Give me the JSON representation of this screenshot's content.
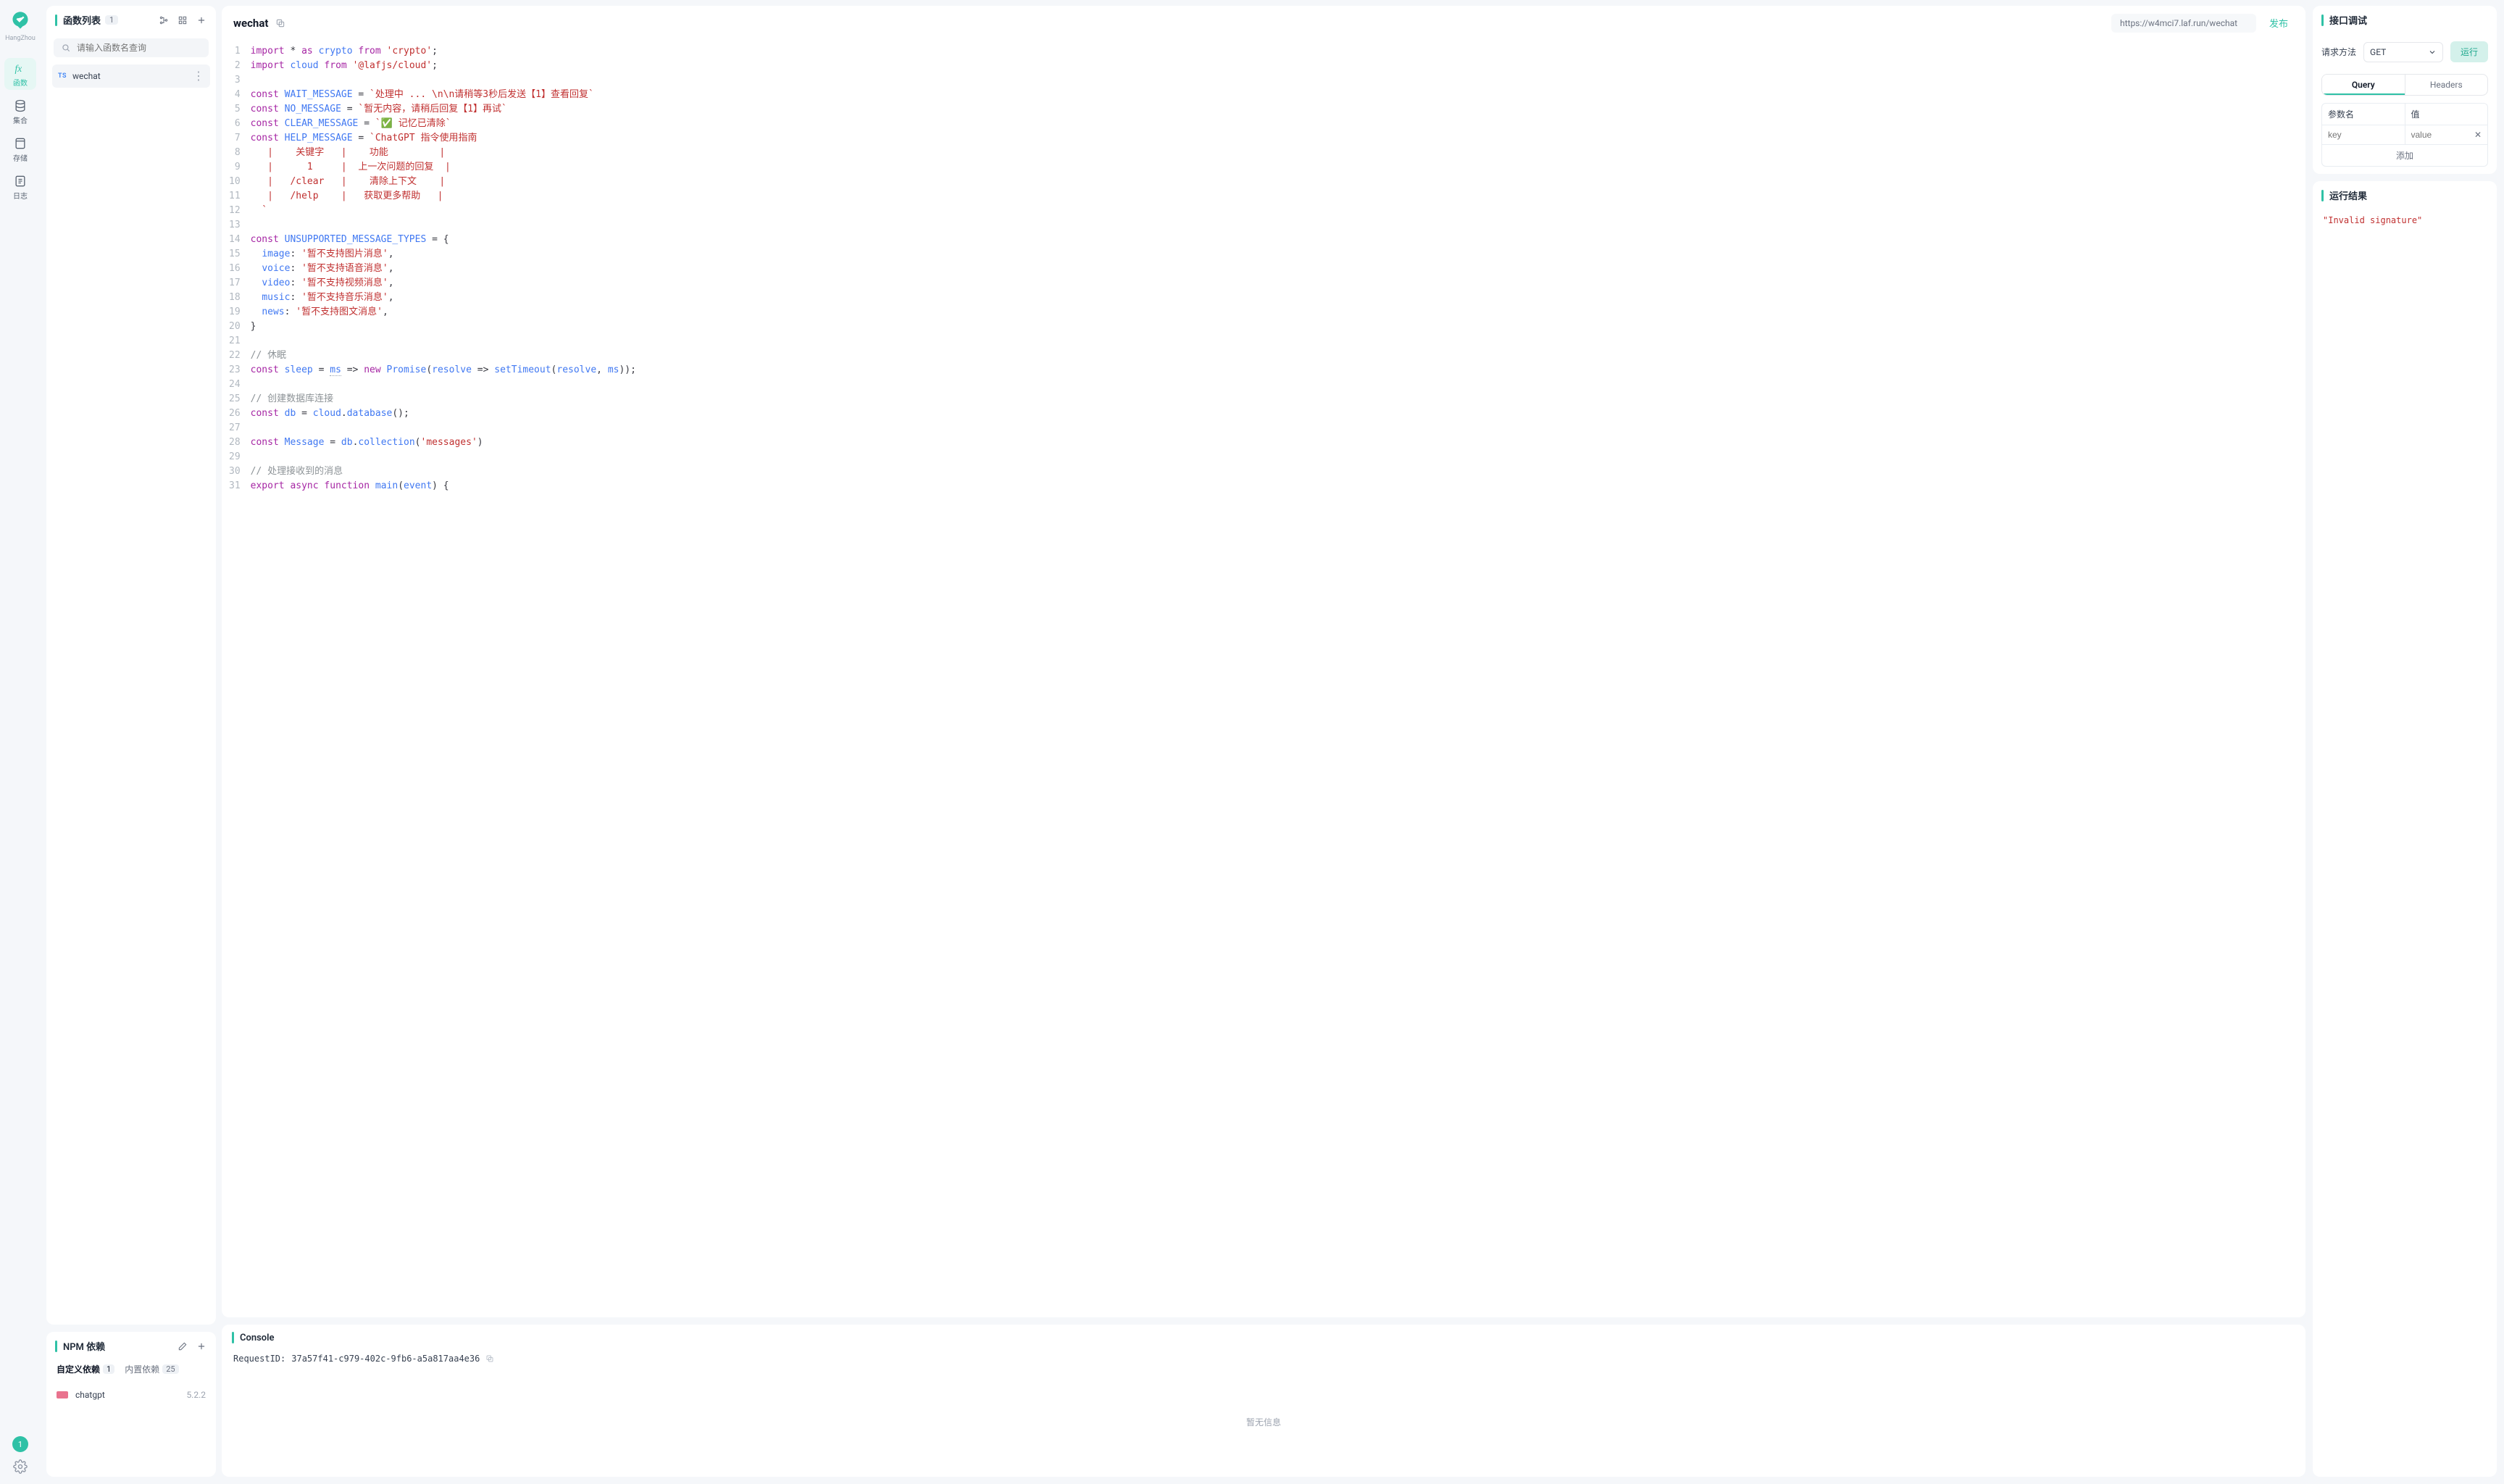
{
  "brand": "HangZhou",
  "rail": {
    "items": [
      {
        "label": "函数"
      },
      {
        "label": "集合"
      },
      {
        "label": "存储"
      },
      {
        "label": "日志"
      }
    ],
    "badge": "1"
  },
  "func_panel": {
    "title": "函数列表",
    "count": "1",
    "search_placeholder": "请输入函数名查询",
    "items": [
      {
        "badge": "TS",
        "name": "wechat"
      }
    ]
  },
  "npm_panel": {
    "title": "NPM 依赖",
    "tabs": [
      {
        "label": "自定义依赖",
        "count": "1"
      },
      {
        "label": "内置依赖",
        "count": "25"
      }
    ],
    "deps": [
      {
        "name": "chatgpt",
        "version": "5.2.2"
      }
    ]
  },
  "editor": {
    "title": "wechat",
    "url": "https://w4mci7.laf.run/wechat",
    "publish": "发布",
    "code_lines": [
      [
        [
          "kw",
          "import"
        ],
        [
          "op",
          " * "
        ],
        [
          "kw",
          "as"
        ],
        [
          "op",
          " "
        ],
        [
          "id",
          "crypto"
        ],
        [
          "op",
          " "
        ],
        [
          "kw",
          "from"
        ],
        [
          "op",
          " "
        ],
        [
          "str",
          "'crypto'"
        ],
        [
          "op",
          ";"
        ]
      ],
      [
        [
          "kw",
          "import"
        ],
        [
          "op",
          " "
        ],
        [
          "id",
          "cloud"
        ],
        [
          "op",
          " "
        ],
        [
          "kw",
          "from"
        ],
        [
          "op",
          " "
        ],
        [
          "str",
          "'@lafjs/cloud'"
        ],
        [
          "op",
          ";"
        ]
      ],
      [],
      [
        [
          "kw",
          "const"
        ],
        [
          "op",
          " "
        ],
        [
          "id",
          "WAIT_MESSAGE"
        ],
        [
          "op",
          " = "
        ],
        [
          "str",
          "`处理中 ... \\n\\n请稍等3秒后发送【1】查看回复`"
        ]
      ],
      [
        [
          "kw",
          "const"
        ],
        [
          "op",
          " "
        ],
        [
          "id",
          "NO_MESSAGE"
        ],
        [
          "op",
          " = "
        ],
        [
          "str",
          "`暂无内容，请稍后回复【1】再试`"
        ]
      ],
      [
        [
          "kw",
          "const"
        ],
        [
          "op",
          " "
        ],
        [
          "id",
          "CLEAR_MESSAGE"
        ],
        [
          "op",
          " = "
        ],
        [
          "str",
          "`✅ 记忆已清除`"
        ]
      ],
      [
        [
          "kw",
          "const"
        ],
        [
          "op",
          " "
        ],
        [
          "id",
          "HELP_MESSAGE"
        ],
        [
          "op",
          " = "
        ],
        [
          "str",
          "`ChatGPT 指令使用指南"
        ]
      ],
      [
        [
          "str",
          "   |    关键字   |    功能         |"
        ]
      ],
      [
        [
          "str",
          "   |      1     |  上一次问题的回复  |"
        ]
      ],
      [
        [
          "str",
          "   |   /clear   |    清除上下文    |"
        ]
      ],
      [
        [
          "str",
          "   |   /help    |   获取更多帮助   |"
        ]
      ],
      [
        [
          "str",
          "  `"
        ]
      ],
      [],
      [
        [
          "kw",
          "const"
        ],
        [
          "op",
          " "
        ],
        [
          "id",
          "UNSUPPORTED_MESSAGE_TYPES"
        ],
        [
          "op",
          " = {"
        ]
      ],
      [
        [
          "op",
          "  "
        ],
        [
          "id",
          "image"
        ],
        [
          "op",
          ": "
        ],
        [
          "str",
          "'暂不支持图片消息'"
        ],
        [
          "op",
          ","
        ]
      ],
      [
        [
          "op",
          "  "
        ],
        [
          "id",
          "voice"
        ],
        [
          "op",
          ": "
        ],
        [
          "str",
          "'暂不支持语音消息'"
        ],
        [
          "op",
          ","
        ]
      ],
      [
        [
          "op",
          "  "
        ],
        [
          "id",
          "video"
        ],
        [
          "op",
          ": "
        ],
        [
          "str",
          "'暂不支持视频消息'"
        ],
        [
          "op",
          ","
        ]
      ],
      [
        [
          "op",
          "  "
        ],
        [
          "id",
          "music"
        ],
        [
          "op",
          ": "
        ],
        [
          "str",
          "'暂不支持音乐消息'"
        ],
        [
          "op",
          ","
        ]
      ],
      [
        [
          "op",
          "  "
        ],
        [
          "id",
          "news"
        ],
        [
          "op",
          ": "
        ],
        [
          "str",
          "'暂不支持图文消息'"
        ],
        [
          "op",
          ","
        ]
      ],
      [
        [
          "op",
          "}"
        ]
      ],
      [],
      [
        [
          "cm",
          "// 休眠"
        ]
      ],
      [
        [
          "kw",
          "const"
        ],
        [
          "op",
          " "
        ],
        [
          "id",
          "sleep"
        ],
        [
          "op",
          " = "
        ],
        [
          "dotted",
          "ms"
        ],
        [
          "op",
          " => "
        ],
        [
          "kw",
          "new"
        ],
        [
          "op",
          " "
        ],
        [
          "fn",
          "Promise"
        ],
        [
          "op",
          "("
        ],
        [
          "id",
          "resolve"
        ],
        [
          "op",
          " => "
        ],
        [
          "fn",
          "setTimeout"
        ],
        [
          "op",
          "("
        ],
        [
          "id",
          "resolve"
        ],
        [
          "op",
          ", "
        ],
        [
          "id",
          "ms"
        ],
        [
          "op",
          "));"
        ]
      ],
      [],
      [
        [
          "cm",
          "// 创建数据库连接"
        ]
      ],
      [
        [
          "kw",
          "const"
        ],
        [
          "op",
          " "
        ],
        [
          "id",
          "db"
        ],
        [
          "op",
          " = "
        ],
        [
          "id",
          "cloud"
        ],
        [
          "op",
          "."
        ],
        [
          "fn",
          "database"
        ],
        [
          "op",
          "();"
        ]
      ],
      [],
      [
        [
          "kw",
          "const"
        ],
        [
          "op",
          " "
        ],
        [
          "id",
          "Message"
        ],
        [
          "op",
          " = "
        ],
        [
          "id",
          "db"
        ],
        [
          "op",
          "."
        ],
        [
          "fn",
          "collection"
        ],
        [
          "op",
          "("
        ],
        [
          "str",
          "'messages'"
        ],
        [
          "op",
          ")"
        ]
      ],
      [],
      [
        [
          "cm",
          "// 处理接收到的消息"
        ]
      ],
      [
        [
          "kw",
          "export"
        ],
        [
          "op",
          " "
        ],
        [
          "kw",
          "async"
        ],
        [
          "op",
          " "
        ],
        [
          "kw",
          "function"
        ],
        [
          "op",
          " "
        ],
        [
          "fn",
          "main"
        ],
        [
          "op",
          "("
        ],
        [
          "id",
          "event"
        ],
        [
          "op",
          ") {"
        ]
      ]
    ]
  },
  "console": {
    "title": "Console",
    "request_id_label": "RequestID: ",
    "request_id_value": "37a57f41-c979-402c-9fb6-a5a817aa4e36",
    "empty": "暂无信息"
  },
  "debug": {
    "title": "接口调试",
    "method_label": "请求方法",
    "method_value": "GET",
    "run": "运行",
    "tabs": [
      {
        "label": "Query"
      },
      {
        "label": "Headers"
      }
    ],
    "kv_headers": {
      "key": "参数名",
      "value": "值"
    },
    "kv_placeholders": {
      "key": "key",
      "value": "value"
    },
    "add": "添加"
  },
  "result": {
    "title": "运行结果",
    "body": "\"Invalid signature\""
  }
}
